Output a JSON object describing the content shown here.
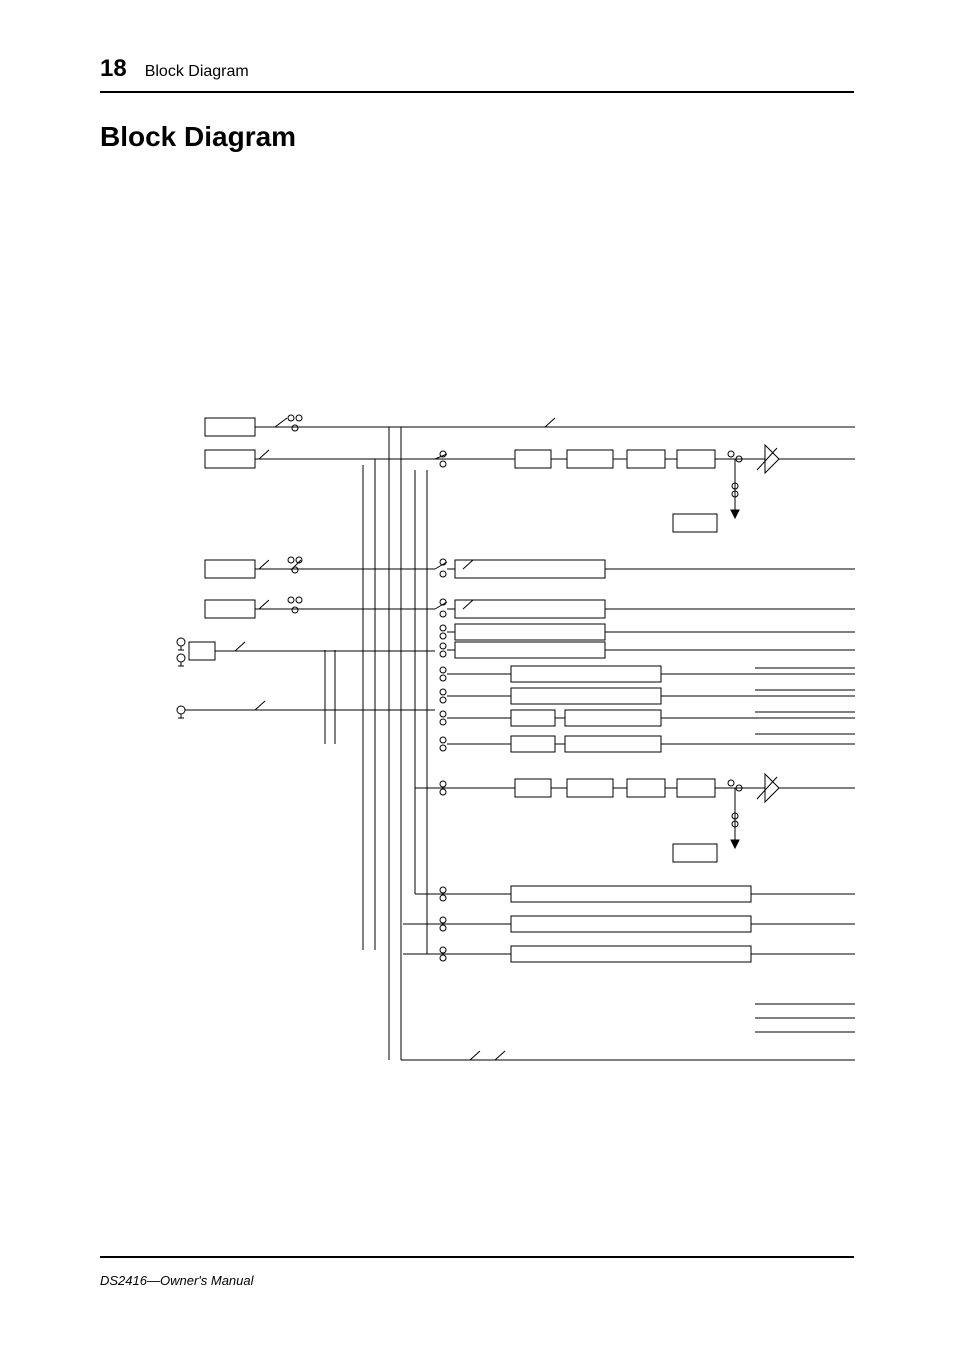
{
  "header": {
    "page_number": "18",
    "section": "Block Diagram"
  },
  "heading": "Block Diagram",
  "footer": "DS2416—Owner's Manual",
  "chart_data": {
    "type": "diagram",
    "description": "Audio signal-flow block diagram (left-page crop). Rectangular processing blocks connected by signal lines, with small circular switch/patch points along the lines and a few fader/triangle symbols at the right edge.",
    "inputs_left": [
      {
        "row": 1,
        "kind": "box",
        "approx_pos": "top-left"
      },
      {
        "row": 2,
        "kind": "box",
        "approx_pos": "top-left (below row 1)"
      },
      {
        "row": 3,
        "kind": "box",
        "approx_pos": "mid-left"
      },
      {
        "row": 4,
        "kind": "box",
        "approx_pos": "mid-left"
      },
      {
        "row": 5,
        "kind": "jack-pair",
        "approx_pos": "mid-left"
      },
      {
        "row": 6,
        "kind": "jack-single",
        "approx_pos": "mid-left"
      }
    ],
    "bus_rows": 10,
    "switch_columns": 2,
    "right_edge_blocks": {
      "count_short_boxes": 6,
      "faders": 2,
      "small_blocks": 6
    },
    "bottom_trunk_lines": 4
  }
}
